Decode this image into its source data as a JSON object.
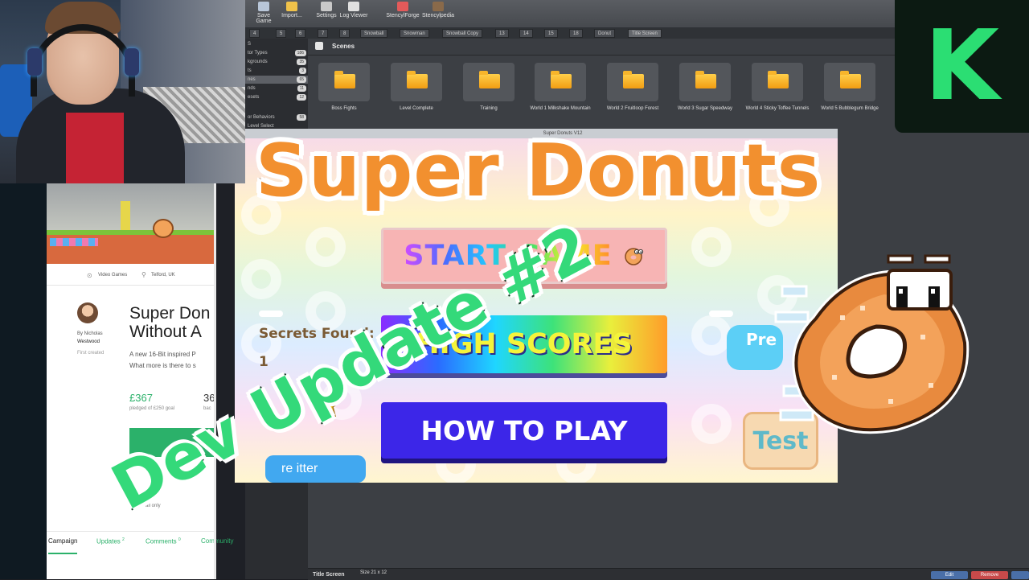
{
  "colors": {
    "kickstarter_green": "#2bde73",
    "title_orange": "#f2902f",
    "dev_green": "#34d97a",
    "start_button": "#f7b4b4",
    "how_button": "#3c26e8"
  },
  "editor": {
    "toolbar": [
      {
        "label": "Save Game",
        "icon": "save-icon"
      },
      {
        "label": "Import...",
        "icon": "import-icon"
      },
      {
        "label": "Settings",
        "icon": "settings-icon"
      },
      {
        "label": "Log Viewer",
        "icon": "log-icon"
      },
      {
        "label": "StencylForge",
        "icon": "forge-icon"
      },
      {
        "label": "Stencylpedia",
        "icon": "book-icon"
      }
    ],
    "tabs": [
      "4",
      "5",
      "6",
      "7",
      "8",
      "Snowball",
      "Snowman",
      "Snowball Copy",
      "13",
      "14",
      "15",
      "18",
      "Donut",
      "Title Screen"
    ],
    "sidebar": [
      {
        "label": "S",
        "count": ""
      },
      {
        "label": "tor Types",
        "count": "186"
      },
      {
        "label": "kgrounds",
        "count": "35"
      },
      {
        "label": "ts",
        "count": "3"
      },
      {
        "label": "nes",
        "count": "65",
        "selected": true
      },
      {
        "label": "nds",
        "count": "11"
      },
      {
        "label": "esets",
        "count": "12"
      },
      {
        "label": "",
        "count": ""
      },
      {
        "label": "or Behaviors",
        "count": "58"
      },
      {
        "label": "Level Select",
        "count": ""
      }
    ],
    "scenes_title": "Scenes",
    "scenes": [
      "Boss Fights",
      "Level Complete",
      "Training",
      "World 1 Milkshake Mountain",
      "World 2 Fruitloop Forest",
      "World 3 Sugar Speedway",
      "World 4 Sticky Toffee Tunnels",
      "World 5 Bubblegum Bridge"
    ],
    "bottom": {
      "scene_name": "Title Screen",
      "size": "Size 21 x 12",
      "edit": "Edit",
      "remove": "Remove"
    }
  },
  "game": {
    "window_title": "Super Donuts V12",
    "start_label": "START GAME",
    "high_label": "HIGH SCORES",
    "how_label": "HOW TO PLAY",
    "secrets_label": "Secrets Found:",
    "secrets_value": "1",
    "press_label": "Pre",
    "test_label": "Test",
    "twitter_label": "re  itter"
  },
  "kickstarter": {
    "category": "Video Games",
    "location": "Telford, UK",
    "title_line1": "Super Don",
    "title_line2": "Without A",
    "by": "By Nicholas",
    "creator": "Westwood",
    "first_created": "First created",
    "desc_line1": "A new 16-Bit inspired P",
    "desc_line2": "What more is there to s",
    "pledged": "£367",
    "pledged_sub": "pledged of £250 goal",
    "backers": "36",
    "backers_sub": "bac",
    "all_or_nothing": "This     all only",
    "tabs": {
      "campaign": "Campaign",
      "updates": "Updates",
      "updates_count": "2",
      "comments": "Comments",
      "comments_count": "0",
      "community": "Community"
    }
  },
  "overlay": {
    "title": "Super Donuts",
    "subtitle": "Dev Update #2",
    "badge": "K"
  }
}
